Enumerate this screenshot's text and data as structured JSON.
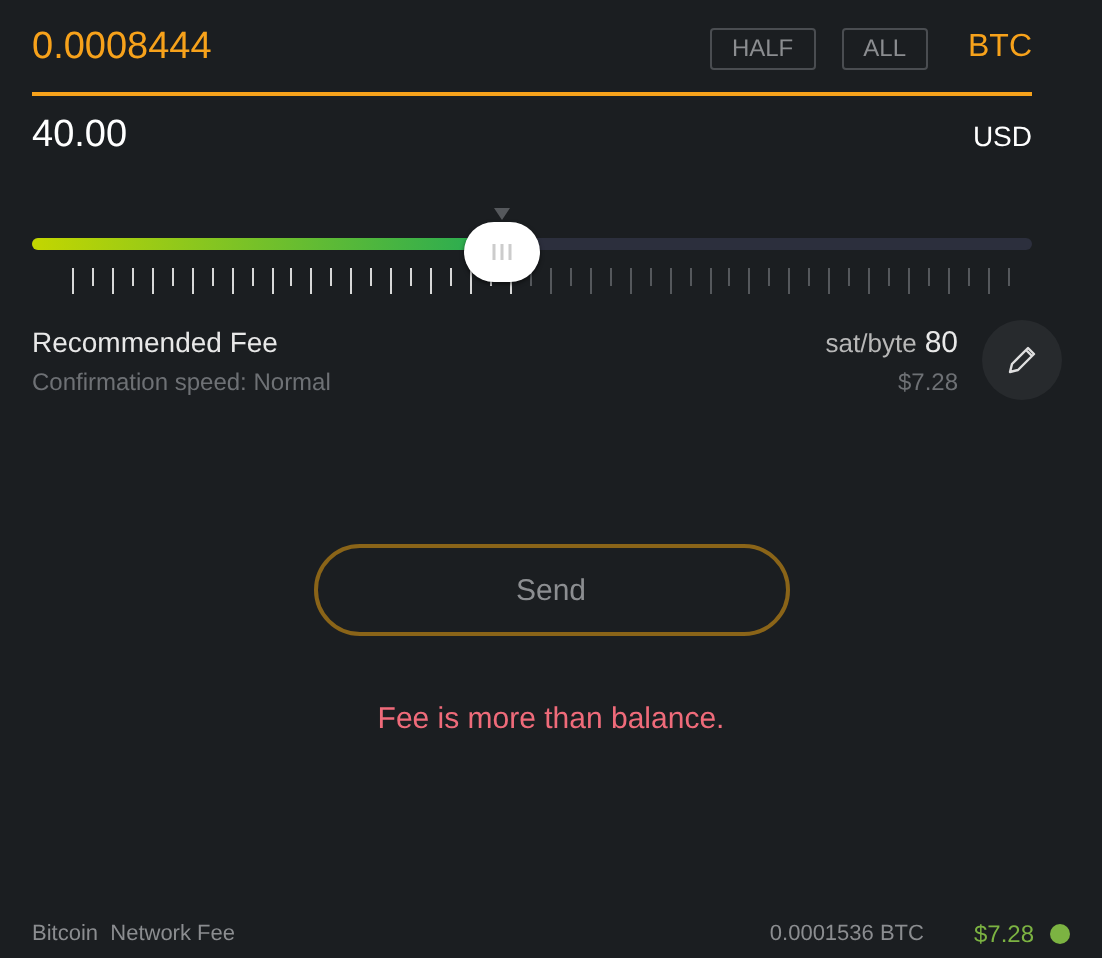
{
  "amount": {
    "value": "0.0008444",
    "buttons": [
      "HALF",
      "ALL"
    ],
    "unit": "BTC"
  },
  "fiat": {
    "value": "40.00",
    "unit": "USD"
  },
  "fee_slider": {
    "level": 0.47
  },
  "fee": {
    "title": "Recommended Fee",
    "subtitle": "Confirmation speed: Normal",
    "rate_label": "sat/byte",
    "rate": "80",
    "fiat": "$7.28"
  },
  "send_button": "Send",
  "error": "Fee is more than balance.",
  "footer": {
    "label": "Bitcoin  Network Fee",
    "btc": "0.0001536 BTC",
    "fiat": "$7.28",
    "color": "#7cb342"
  }
}
